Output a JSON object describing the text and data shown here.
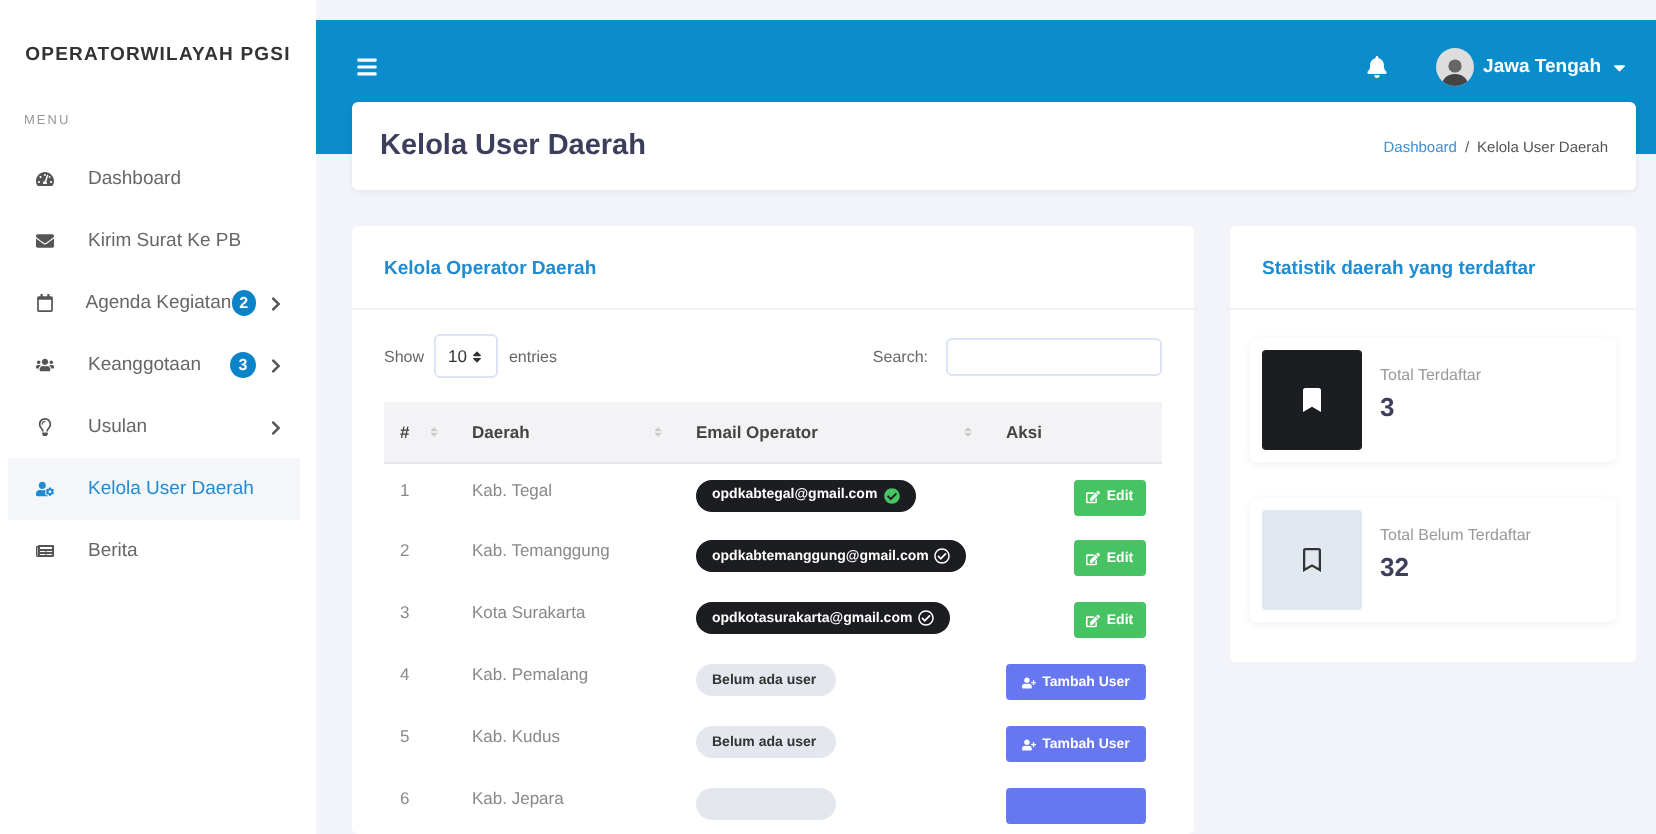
{
  "sidebar": {
    "brand": "OPERATORWILAYAH PGSI",
    "section": "MENU",
    "items": [
      {
        "label": "Dashboard",
        "selected": false
      },
      {
        "label": "Kirim Surat Ke PB",
        "selected": false
      },
      {
        "label": "Agenda Kegiatan",
        "badge": "2",
        "expandable": true,
        "selected": false
      },
      {
        "label": "Keanggotaan",
        "badge": "3",
        "expandable": true,
        "selected": false
      },
      {
        "label": "Usulan",
        "expandable": true,
        "selected": false
      },
      {
        "label": "Kelola User Daerah",
        "selected": true
      },
      {
        "label": "Berita",
        "selected": false
      }
    ]
  },
  "topbar": {
    "user": "Jawa Tengah"
  },
  "page_header": {
    "title": "Kelola User Daerah",
    "separator": "/",
    "breadcrumb": [
      {
        "label": "Dashboard",
        "link": true
      },
      {
        "label": "Kelola User Daerah",
        "link": false
      }
    ]
  },
  "table_card": {
    "title": "Kelola Operator Daerah",
    "show_label": "Show",
    "entries_value": "10",
    "entries_label": "entries",
    "search_label": "Search:",
    "columns": [
      "#",
      "Daerah",
      "Email Operator",
      "Aksi"
    ],
    "rows": [
      {
        "no": "1",
        "daerah": "Kab. Tegal",
        "kind": "registered",
        "email": "opdkabtegal@gmail.com",
        "verified": true,
        "action": "Edit"
      },
      {
        "no": "2",
        "daerah": "Kab. Temanggung",
        "kind": "registered",
        "email": "opdkabtemanggung@gmail.com",
        "verified": false,
        "action": "Edit"
      },
      {
        "no": "3",
        "daerah": "Kota Surakarta",
        "kind": "registered",
        "email": "opdkotasurakarta@gmail.com",
        "verified": false,
        "action": "Edit"
      },
      {
        "no": "4",
        "daerah": "Kab. Pemalang",
        "kind": "empty",
        "status": "Belum ada user",
        "action": "Tambah User"
      },
      {
        "no": "5",
        "daerah": "Kab. Kudus",
        "kind": "empty",
        "status": "Belum ada user",
        "action": "Tambah User"
      },
      {
        "no": "6",
        "daerah": "Kab. Jepara",
        "kind": "empty"
      }
    ]
  },
  "stats_card": {
    "title": "Statistik daerah yang terdaftar",
    "stats": [
      {
        "kind": "filled",
        "label": "Total Terdaftar",
        "value": "3"
      },
      {
        "kind": "outline",
        "label": "Total Belum Terdaftar",
        "value": "32"
      }
    ]
  }
}
